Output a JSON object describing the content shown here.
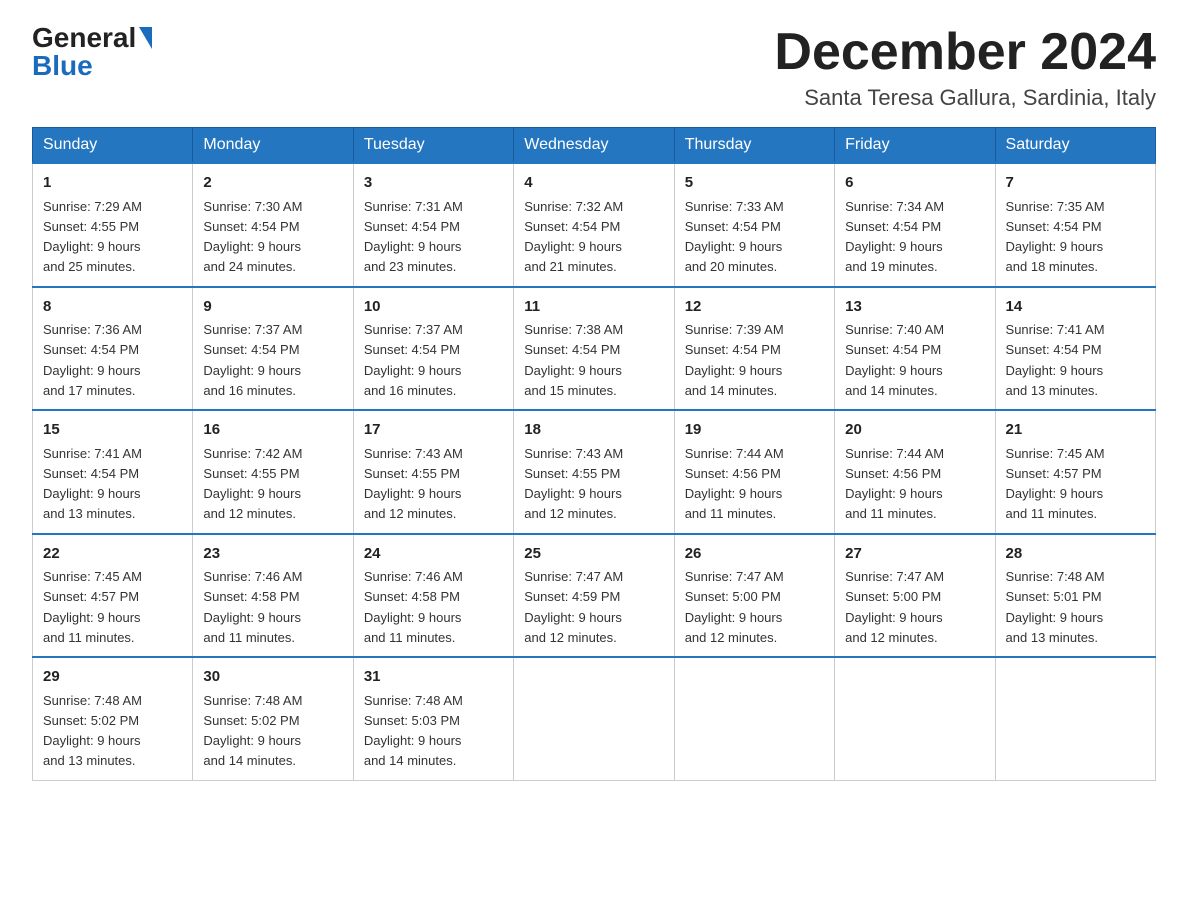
{
  "logo": {
    "general": "General",
    "blue": "Blue",
    "arrow": "▶"
  },
  "header": {
    "month_title": "December 2024",
    "location": "Santa Teresa Gallura, Sardinia, Italy"
  },
  "weekdays": [
    "Sunday",
    "Monday",
    "Tuesday",
    "Wednesday",
    "Thursday",
    "Friday",
    "Saturday"
  ],
  "weeks": [
    [
      {
        "day": "1",
        "sunrise": "7:29 AM",
        "sunset": "4:55 PM",
        "daylight": "9 hours and 25 minutes."
      },
      {
        "day": "2",
        "sunrise": "7:30 AM",
        "sunset": "4:54 PM",
        "daylight": "9 hours and 24 minutes."
      },
      {
        "day": "3",
        "sunrise": "7:31 AM",
        "sunset": "4:54 PM",
        "daylight": "9 hours and 23 minutes."
      },
      {
        "day": "4",
        "sunrise": "7:32 AM",
        "sunset": "4:54 PM",
        "daylight": "9 hours and 21 minutes."
      },
      {
        "day": "5",
        "sunrise": "7:33 AM",
        "sunset": "4:54 PM",
        "daylight": "9 hours and 20 minutes."
      },
      {
        "day": "6",
        "sunrise": "7:34 AM",
        "sunset": "4:54 PM",
        "daylight": "9 hours and 19 minutes."
      },
      {
        "day": "7",
        "sunrise": "7:35 AM",
        "sunset": "4:54 PM",
        "daylight": "9 hours and 18 minutes."
      }
    ],
    [
      {
        "day": "8",
        "sunrise": "7:36 AM",
        "sunset": "4:54 PM",
        "daylight": "9 hours and 17 minutes."
      },
      {
        "day": "9",
        "sunrise": "7:37 AM",
        "sunset": "4:54 PM",
        "daylight": "9 hours and 16 minutes."
      },
      {
        "day": "10",
        "sunrise": "7:37 AM",
        "sunset": "4:54 PM",
        "daylight": "9 hours and 16 minutes."
      },
      {
        "day": "11",
        "sunrise": "7:38 AM",
        "sunset": "4:54 PM",
        "daylight": "9 hours and 15 minutes."
      },
      {
        "day": "12",
        "sunrise": "7:39 AM",
        "sunset": "4:54 PM",
        "daylight": "9 hours and 14 minutes."
      },
      {
        "day": "13",
        "sunrise": "7:40 AM",
        "sunset": "4:54 PM",
        "daylight": "9 hours and 14 minutes."
      },
      {
        "day": "14",
        "sunrise": "7:41 AM",
        "sunset": "4:54 PM",
        "daylight": "9 hours and 13 minutes."
      }
    ],
    [
      {
        "day": "15",
        "sunrise": "7:41 AM",
        "sunset": "4:54 PM",
        "daylight": "9 hours and 13 minutes."
      },
      {
        "day": "16",
        "sunrise": "7:42 AM",
        "sunset": "4:55 PM",
        "daylight": "9 hours and 12 minutes."
      },
      {
        "day": "17",
        "sunrise": "7:43 AM",
        "sunset": "4:55 PM",
        "daylight": "9 hours and 12 minutes."
      },
      {
        "day": "18",
        "sunrise": "7:43 AM",
        "sunset": "4:55 PM",
        "daylight": "9 hours and 12 minutes."
      },
      {
        "day": "19",
        "sunrise": "7:44 AM",
        "sunset": "4:56 PM",
        "daylight": "9 hours and 11 minutes."
      },
      {
        "day": "20",
        "sunrise": "7:44 AM",
        "sunset": "4:56 PM",
        "daylight": "9 hours and 11 minutes."
      },
      {
        "day": "21",
        "sunrise": "7:45 AM",
        "sunset": "4:57 PM",
        "daylight": "9 hours and 11 minutes."
      }
    ],
    [
      {
        "day": "22",
        "sunrise": "7:45 AM",
        "sunset": "4:57 PM",
        "daylight": "9 hours and 11 minutes."
      },
      {
        "day": "23",
        "sunrise": "7:46 AM",
        "sunset": "4:58 PM",
        "daylight": "9 hours and 11 minutes."
      },
      {
        "day": "24",
        "sunrise": "7:46 AM",
        "sunset": "4:58 PM",
        "daylight": "9 hours and 11 minutes."
      },
      {
        "day": "25",
        "sunrise": "7:47 AM",
        "sunset": "4:59 PM",
        "daylight": "9 hours and 12 minutes."
      },
      {
        "day": "26",
        "sunrise": "7:47 AM",
        "sunset": "5:00 PM",
        "daylight": "9 hours and 12 minutes."
      },
      {
        "day": "27",
        "sunrise": "7:47 AM",
        "sunset": "5:00 PM",
        "daylight": "9 hours and 12 minutes."
      },
      {
        "day": "28",
        "sunrise": "7:48 AM",
        "sunset": "5:01 PM",
        "daylight": "9 hours and 13 minutes."
      }
    ],
    [
      {
        "day": "29",
        "sunrise": "7:48 AM",
        "sunset": "5:02 PM",
        "daylight": "9 hours and 13 minutes."
      },
      {
        "day": "30",
        "sunrise": "7:48 AM",
        "sunset": "5:02 PM",
        "daylight": "9 hours and 14 minutes."
      },
      {
        "day": "31",
        "sunrise": "7:48 AM",
        "sunset": "5:03 PM",
        "daylight": "9 hours and 14 minutes."
      },
      null,
      null,
      null,
      null
    ]
  ],
  "labels": {
    "sunrise": "Sunrise:",
    "sunset": "Sunset:",
    "daylight": "Daylight:"
  }
}
